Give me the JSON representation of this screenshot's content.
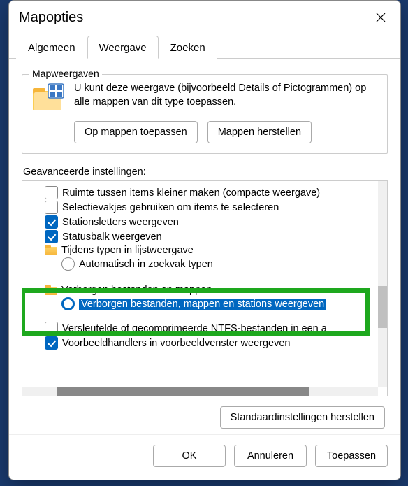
{
  "title": "Mapopties",
  "tabs": {
    "general": "Algemeen",
    "view": "Weergave",
    "search": "Zoeken"
  },
  "folderviews": {
    "group_label": "Mapweergaven",
    "text": "U kunt deze weergave (bijvoorbeeld Details of Pictogrammen) op alle mappen van dit type toepassen.",
    "apply_btn": "Op mappen toepassen",
    "reset_btn": "Mappen herstellen"
  },
  "advanced": {
    "label": "Geavanceerde instellingen:",
    "items": {
      "compact": "Ruimte tussen items kleiner maken (compacte weergave)",
      "checkboxes": "Selectievakjes gebruiken om items te selecteren",
      "driveletters": "Stationsletters weergeven",
      "statusbar": "Statusbalk weergeven",
      "typing_group": "Tijdens typen in lijstweergave",
      "typing_auto": "Automatisch in zoekvak typen",
      "hidden_group": "Verborgen bestanden en mappen",
      "hidden_show": "Verborgen bestanden, mappen en stations weergeven",
      "ntfs": "Versleutelde of gecomprimeerde NTFS-bestanden in een a",
      "preview": "Voorbeeldhandlers in voorbeeldvenster weergeven"
    },
    "reset_defaults": "Standaardinstellingen herstellen"
  },
  "footer": {
    "ok": "OK",
    "cancel": "Annuleren",
    "apply": "Toepassen"
  }
}
